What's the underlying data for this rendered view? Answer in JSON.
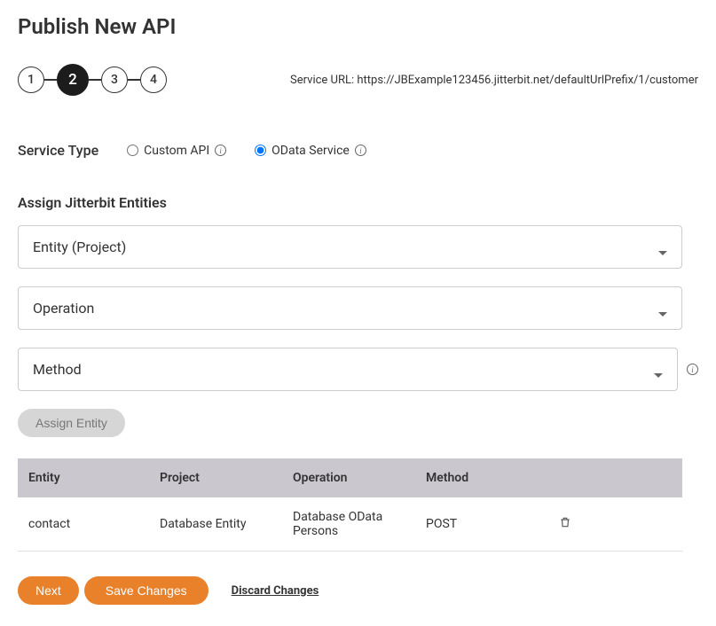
{
  "page": {
    "title": "Publish New API",
    "serviceUrlLabel": "Service URL:",
    "serviceUrl": "https://JBExample123456.jitterbit.net/defaultUrlPrefix/1/customer"
  },
  "stepper": {
    "steps": [
      "1",
      "2",
      "3",
      "4"
    ],
    "activeIndex": 1
  },
  "serviceType": {
    "label": "Service Type",
    "options": [
      {
        "label": "Custom API",
        "selected": false
      },
      {
        "label": "OData Service",
        "selected": true
      }
    ]
  },
  "assign": {
    "label": "Assign Jitterbit Entities",
    "dropdowns": {
      "entity": "Entity (Project)",
      "operation": "Operation",
      "method": "Method"
    },
    "assignButton": "Assign Entity"
  },
  "table": {
    "headers": {
      "entity": "Entity",
      "project": "Project",
      "operation": "Operation",
      "method": "Method",
      "action": ""
    },
    "rows": [
      {
        "entity": "contact",
        "project": "Database Entity",
        "operation": "Database OData Persons",
        "method": "POST"
      }
    ]
  },
  "actions": {
    "next": "Next",
    "save": "Save Changes",
    "discard": "Discard Changes"
  }
}
